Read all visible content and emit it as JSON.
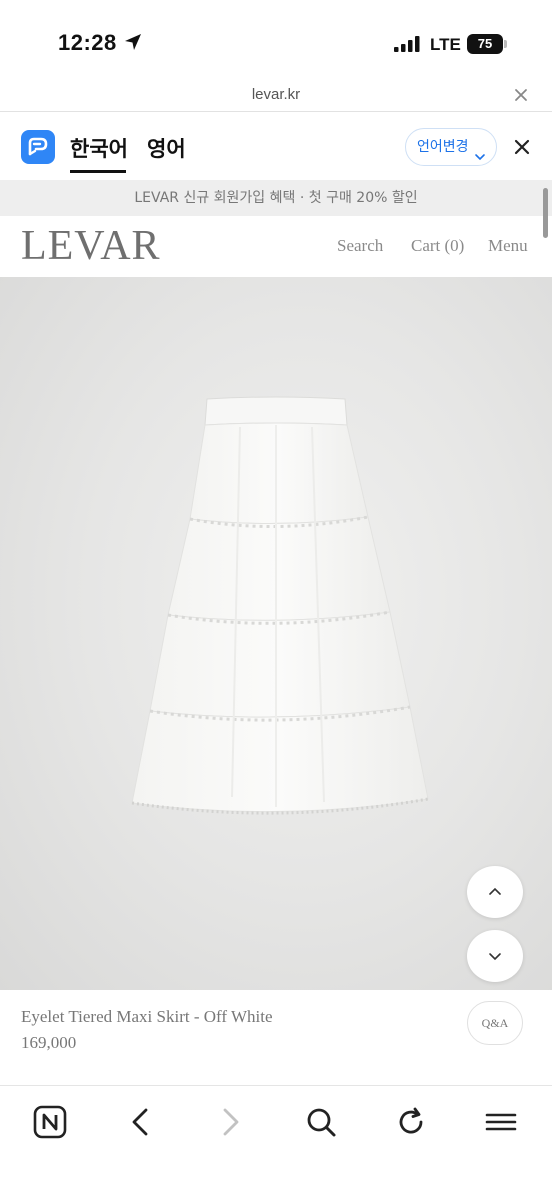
{
  "status_bar": {
    "time": "12:28",
    "network": "LTE",
    "battery": "75"
  },
  "browser": {
    "url": "levar.kr"
  },
  "translate_bar": {
    "lang_current": "한국어",
    "lang_other": "영어",
    "change_label": "언어변경"
  },
  "promo": {
    "text": "LEVAR 신규 회원가입 혜택 · 첫 구매 20% 할인"
  },
  "header": {
    "brand": "LEVAR",
    "search": "Search",
    "cart": "Cart (0)",
    "menu": "Menu"
  },
  "product": {
    "name": "Eyelet Tiered Maxi Skirt - Off White",
    "price": "169,000",
    "qa_label": "Q&A"
  },
  "icons": {
    "location": "location-arrow-icon",
    "signal": "signal-bars-icon",
    "url_close": "close-icon",
    "translate_logo": "papago-logo-icon",
    "scroll_up": "chevron-up-icon",
    "scroll_down": "chevron-down-icon",
    "toolbar": [
      "naver-home-icon",
      "back-icon",
      "forward-icon",
      "search-icon",
      "reload-icon",
      "menu-icon"
    ]
  },
  "colors": {
    "accent_blue": "#1d72e8",
    "logo_blue": "#2f86f6",
    "brand_gray": "#6f6f6f",
    "promo_bg": "#eeeeee"
  }
}
